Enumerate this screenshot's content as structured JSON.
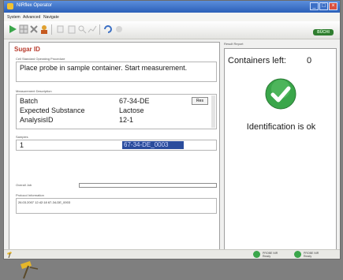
{
  "window": {
    "title": "NIRflex Operator",
    "min": "_",
    "max": "□",
    "close": "×"
  },
  "menu": [
    "System",
    "Advanced",
    "Navigate"
  ],
  "toolbar": {
    "logo": "BÜCHI"
  },
  "left": {
    "title": "Sugar ID",
    "instruction_label": "Cell Standard Operating Procedure",
    "instruction": "Place probe in sample container. Start measurement.",
    "assessment_label": "Measurement Description",
    "rows": [
      {
        "key": "Batch",
        "value": "67-34-DE"
      },
      {
        "key": "Expected Substance",
        "value": "Lactose"
      },
      {
        "key": "AnalysisID",
        "value": "12-1"
      }
    ],
    "dropdown_label": "Res",
    "sample_label": "Samples",
    "sample_num": "1",
    "sample_id": "67-34-DE_0003",
    "progress_label": "Overall Job",
    "status_label": "Protocol Information",
    "status_text": "26.03.2007    12:42:18    67-34-DE_0003"
  },
  "right": {
    "tab": "Result Report",
    "containers_label": "Containers left:",
    "containers_count": "0",
    "result": "Identification is ok"
  },
  "statusbar": {
    "left_text": "",
    "mid_label": "PROBE NIR",
    "mid_sub": "Ready",
    "right_label": "PROBE NIR",
    "right_sub": "Ready"
  },
  "colors": {
    "title_red": "#b83b2d",
    "selection": "#2a4c9c",
    "ok_green": "#3aa64a"
  }
}
